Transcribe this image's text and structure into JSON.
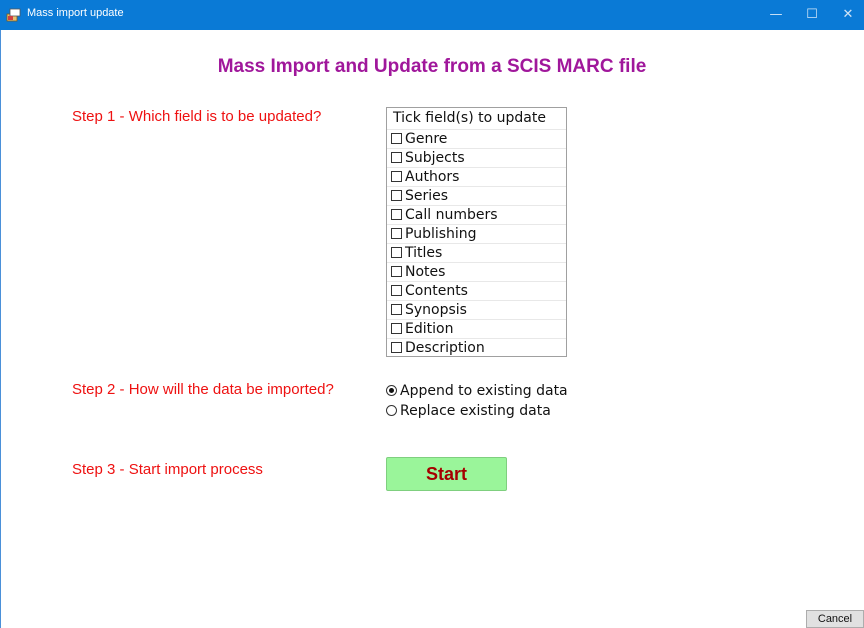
{
  "window": {
    "title": "Mass import update",
    "minimize_glyph": "—",
    "maximize_glyph": "☐",
    "close_glyph": "✕",
    "app_icon": "app-icon"
  },
  "heading": "Mass Import and Update from a SCIS MARC file",
  "step1": {
    "label": "Step 1 - Which field is to be updated?",
    "list_header": "Tick field(s) to update",
    "fields": [
      {
        "label": "Genre",
        "checked": false
      },
      {
        "label": "Subjects",
        "checked": false
      },
      {
        "label": "Authors",
        "checked": false
      },
      {
        "label": "Series",
        "checked": false
      },
      {
        "label": "Call numbers",
        "checked": false
      },
      {
        "label": "Publishing",
        "checked": false
      },
      {
        "label": "Titles",
        "checked": false
      },
      {
        "label": "Notes",
        "checked": false
      },
      {
        "label": "Contents",
        "checked": false
      },
      {
        "label": "Synopsis",
        "checked": false
      },
      {
        "label": "Edition",
        "checked": false
      },
      {
        "label": "Description",
        "checked": false
      }
    ]
  },
  "step2": {
    "label": "Step 2 - How will the data be imported?",
    "options": [
      {
        "label": "Append to existing data",
        "selected": true
      },
      {
        "label": "Replace existing data",
        "selected": false
      }
    ]
  },
  "step3": {
    "label": "Step 3 - Start import process",
    "start_label": "Start"
  },
  "cancel_label": "Cancel",
  "colors": {
    "titlebar": "#0a7ad6",
    "heading": "#a0179b",
    "step_text": "#ee1111",
    "start_bg": "#9af59a",
    "start_text": "#a50000"
  }
}
